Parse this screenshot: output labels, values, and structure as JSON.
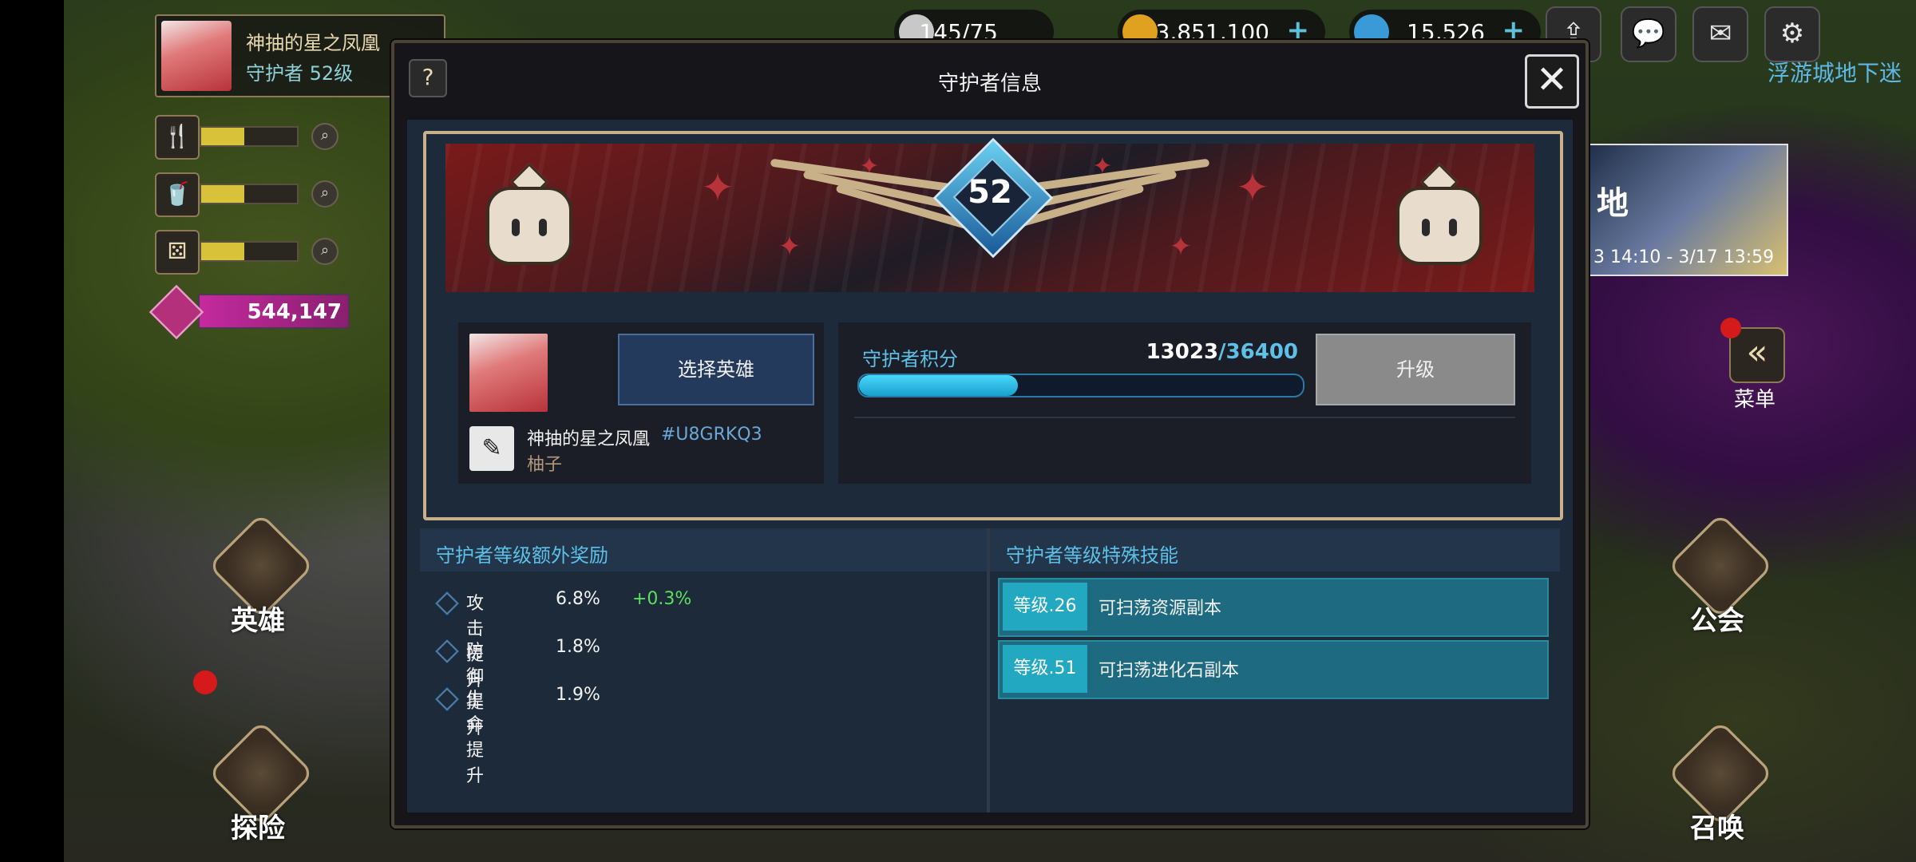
{
  "player": {
    "name": "神抽的星之凤凰",
    "title_level": "守护者 52级"
  },
  "hud": {
    "gems": "544,147",
    "stamina_icons": [
      "fork-knife-icon",
      "cup-icon",
      "dice-icon"
    ],
    "stamina_fill": [
      0.45,
      0.45,
      0.45
    ]
  },
  "currency": [
    {
      "name": "stamina",
      "value": "145/75"
    },
    {
      "name": "gold",
      "value": "3,851,100"
    },
    {
      "name": "diamond",
      "value": "15,526"
    }
  ],
  "map_label": "浮游城地下迷",
  "event": {
    "title": "地",
    "date": "3 14:10 - 3/17 13:59"
  },
  "menu": {
    "label": "菜单",
    "icon": "«"
  },
  "nav": {
    "hero": "英雄",
    "explore": "探险",
    "guild": "公会",
    "summon": "召唤"
  },
  "modal": {
    "title": "守护者信息",
    "help": "?",
    "close": "✕",
    "level": "52",
    "profile": {
      "select_hero": "选择英雄",
      "name": "神抽的星之凤凰",
      "id": "#U8GRKQ3",
      "sub": "柚子"
    },
    "score": {
      "label": "守护者积分",
      "current": "13023",
      "max": "/36400",
      "fill": 0.358,
      "upgrade": "升级"
    },
    "bonus": {
      "title": "守护者等级额外奖励",
      "items": [
        {
          "label": "攻击提升",
          "value": "6.8%",
          "extra": "+0.3%"
        },
        {
          "label": "防御提升",
          "value": "1.8%",
          "extra": ""
        },
        {
          "label": "生命提升",
          "value": "1.9%",
          "extra": ""
        }
      ]
    },
    "skills": {
      "title": "守护者等级特殊技能",
      "items": [
        {
          "level": "等级.26",
          "text": "可扫荡资源副本"
        },
        {
          "level": "等级.51",
          "text": "可扫荡进化石副本"
        }
      ]
    }
  },
  "colors": {
    "accent": "#5ec0e6",
    "frame": "#c8b088",
    "green": "#5ce05c"
  }
}
